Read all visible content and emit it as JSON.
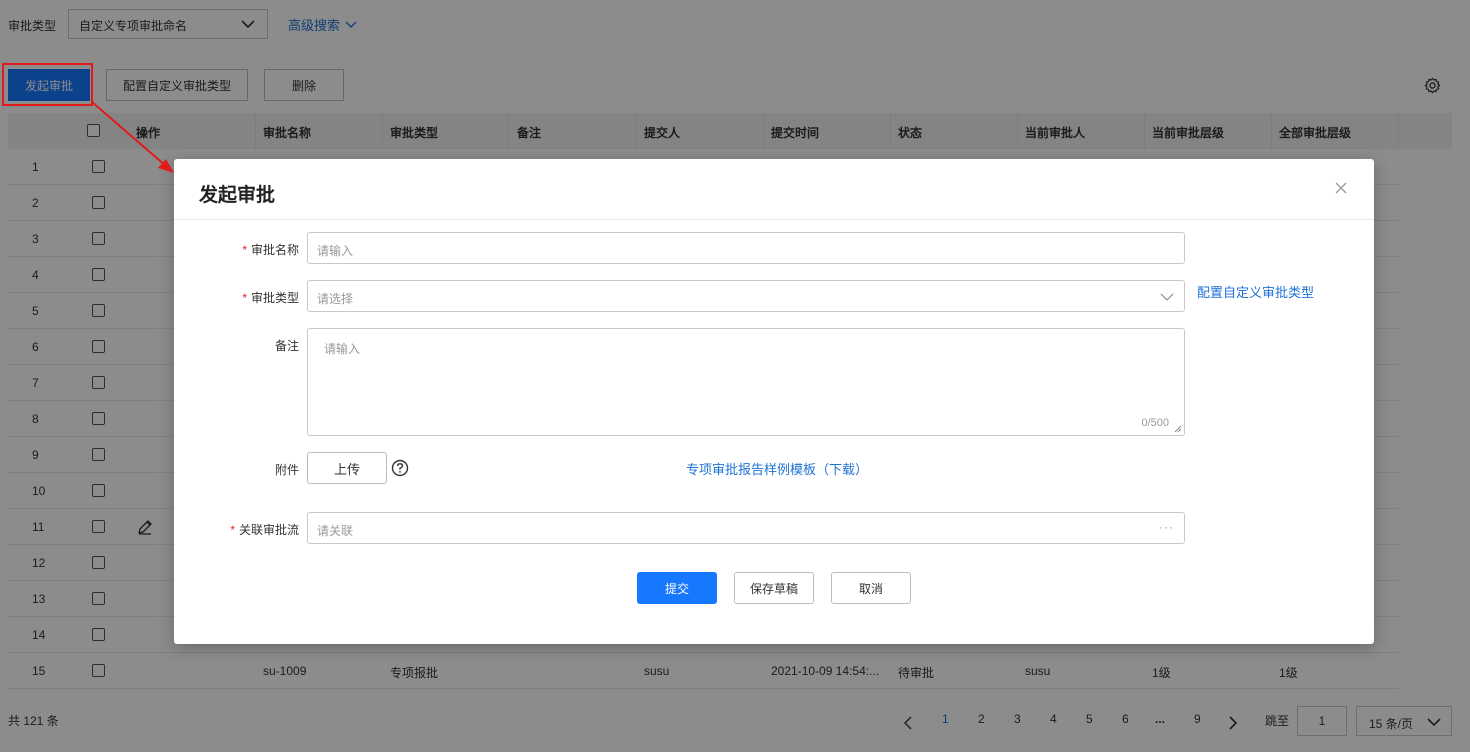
{
  "filter": {
    "label": "审批类型",
    "select_value": "自定义专项审批命名",
    "advanced_search": "高级搜索"
  },
  "toolbar": {
    "launch": "发起审批",
    "config_types": "配置自定义审批类型",
    "delete": "删除"
  },
  "table": {
    "headers": [
      "操作",
      "审批名称",
      "审批类型",
      "备注",
      "提交人",
      "提交时间",
      "状态",
      "当前审批人",
      "当前审批层级",
      "全部审批层级"
    ],
    "row_numbers": [
      "1",
      "2",
      "3",
      "4",
      "5",
      "6",
      "7",
      "8",
      "9",
      "10",
      "11",
      "12",
      "13",
      "14",
      "15"
    ],
    "row15": {
      "name": "su-1009",
      "type": "专项报批",
      "submitter": "susu",
      "time": "2021-10-09 14:54:...",
      "status": "待审批",
      "current_approver": "susu",
      "current_level": "1级",
      "all_levels": "1级"
    }
  },
  "footer": {
    "total": "共 121 条",
    "pages": [
      "1",
      "2",
      "3",
      "4",
      "5",
      "6",
      "...",
      "9"
    ],
    "active_page": "1",
    "jump_label": "跳至",
    "jump_value": "1",
    "page_size": "15 条/页"
  },
  "modal": {
    "title": "发起审批",
    "name_label": "审批名称",
    "name_placeholder": "请输入",
    "type_label": "审批类型",
    "type_placeholder": "请选择",
    "config_link": "配置自定义审批类型",
    "remark_label": "备注",
    "remark_placeholder": "请输入",
    "remark_count": "0/500",
    "attach_label": "附件",
    "upload": "上传",
    "template_link": "专项审批报告样例模板（下载）",
    "flow_label": "关联审批流",
    "flow_placeholder": "请关联",
    "flow_dots": "···",
    "submit": "提交",
    "save_draft": "保存草稿",
    "cancel": "取消"
  },
  "colors": {
    "primary": "#1677ff",
    "link": "#1f72d6",
    "annotation": "#e01b1b",
    "required": "#e02020"
  },
  "icons": [
    "chevron-down-icon",
    "gear-icon",
    "pencil-icon",
    "close-icon",
    "help-icon",
    "chevron-left-icon",
    "chevron-right-icon"
  ]
}
